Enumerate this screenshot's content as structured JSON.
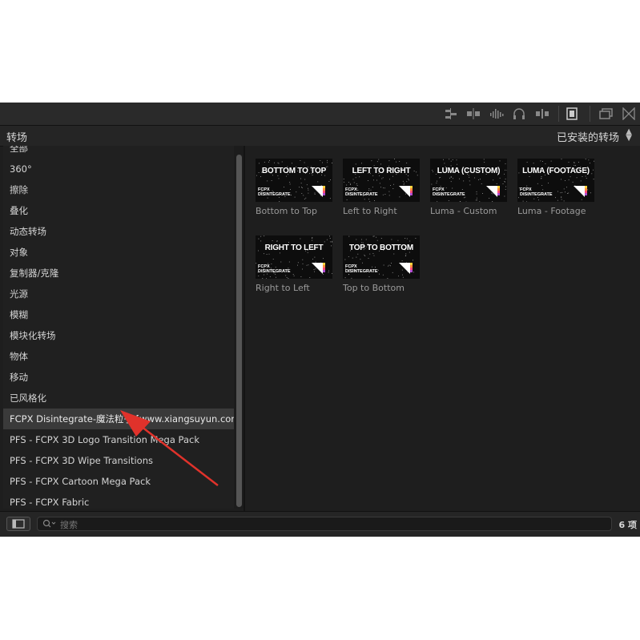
{
  "header": {
    "title": "转场",
    "filter_label": "已安装的转场"
  },
  "sidebar": {
    "items": [
      {
        "label": "全部"
      },
      {
        "label": "360°"
      },
      {
        "label": "擦除"
      },
      {
        "label": "叠化"
      },
      {
        "label": "动态转场"
      },
      {
        "label": "对象"
      },
      {
        "label": "复制器/克隆"
      },
      {
        "label": "光源"
      },
      {
        "label": "模糊"
      },
      {
        "label": "模块化转场"
      },
      {
        "label": "物体"
      },
      {
        "label": "移动"
      },
      {
        "label": "已风格化"
      },
      {
        "label": "FCPX Disintegrate-魔法粒子 [www.xiangsuyun.com]",
        "selected": true
      },
      {
        "label": "PFS - FCPX 3D Logo Transition Mega Pack"
      },
      {
        "label": "PFS - FCPX 3D Wipe Transitions"
      },
      {
        "label": "PFS - FCPX Cartoon Mega Pack"
      },
      {
        "label": "PFS - FCPX Fabric"
      }
    ]
  },
  "transitions": [
    {
      "thumb_title": "BOTTOM TO TOP",
      "label": "Bottom to Top",
      "logo_line1": "FCPX",
      "logo_line2": "DISINTEGRATE"
    },
    {
      "thumb_title": "LEFT TO RIGHT",
      "label": "Left to Right",
      "logo_line1": "FCPX",
      "logo_line2": "DISINTEGRATE"
    },
    {
      "thumb_title": "LUMA (CUSTOM)",
      "label": "Luma - Custom",
      "logo_line1": "FCPX",
      "logo_line2": "DISINTEGRATE"
    },
    {
      "thumb_title": "LUMA (FOOTAGE)",
      "label": "Luma - Footage",
      "logo_line1": "FCPX",
      "logo_line2": "DISINTEGRATE"
    },
    {
      "thumb_title": "RIGHT TO LEFT",
      "label": "Right to Left",
      "logo_line1": "FCPX",
      "logo_line2": "DISINTEGRATE"
    },
    {
      "thumb_title": "TOP TO BOTTOM",
      "label": "Top to Bottom",
      "logo_line1": "FCPX",
      "logo_line2": "DISINTEGRATE"
    }
  ],
  "footer": {
    "search_placeholder": "搜索",
    "count": "6 项"
  },
  "colors": {
    "panel_bg": "#1e1e1e",
    "selected_bg": "#3a3a3a",
    "arrow": "#e0322b"
  },
  "icons": {
    "toolbar": [
      "clip-connect-icon",
      "clip-split-icon",
      "audio-waveform-icon",
      "headphones-icon",
      "trim-icon",
      "filmstrip-icon",
      "window-icon",
      "transitions-browser-icon"
    ]
  }
}
